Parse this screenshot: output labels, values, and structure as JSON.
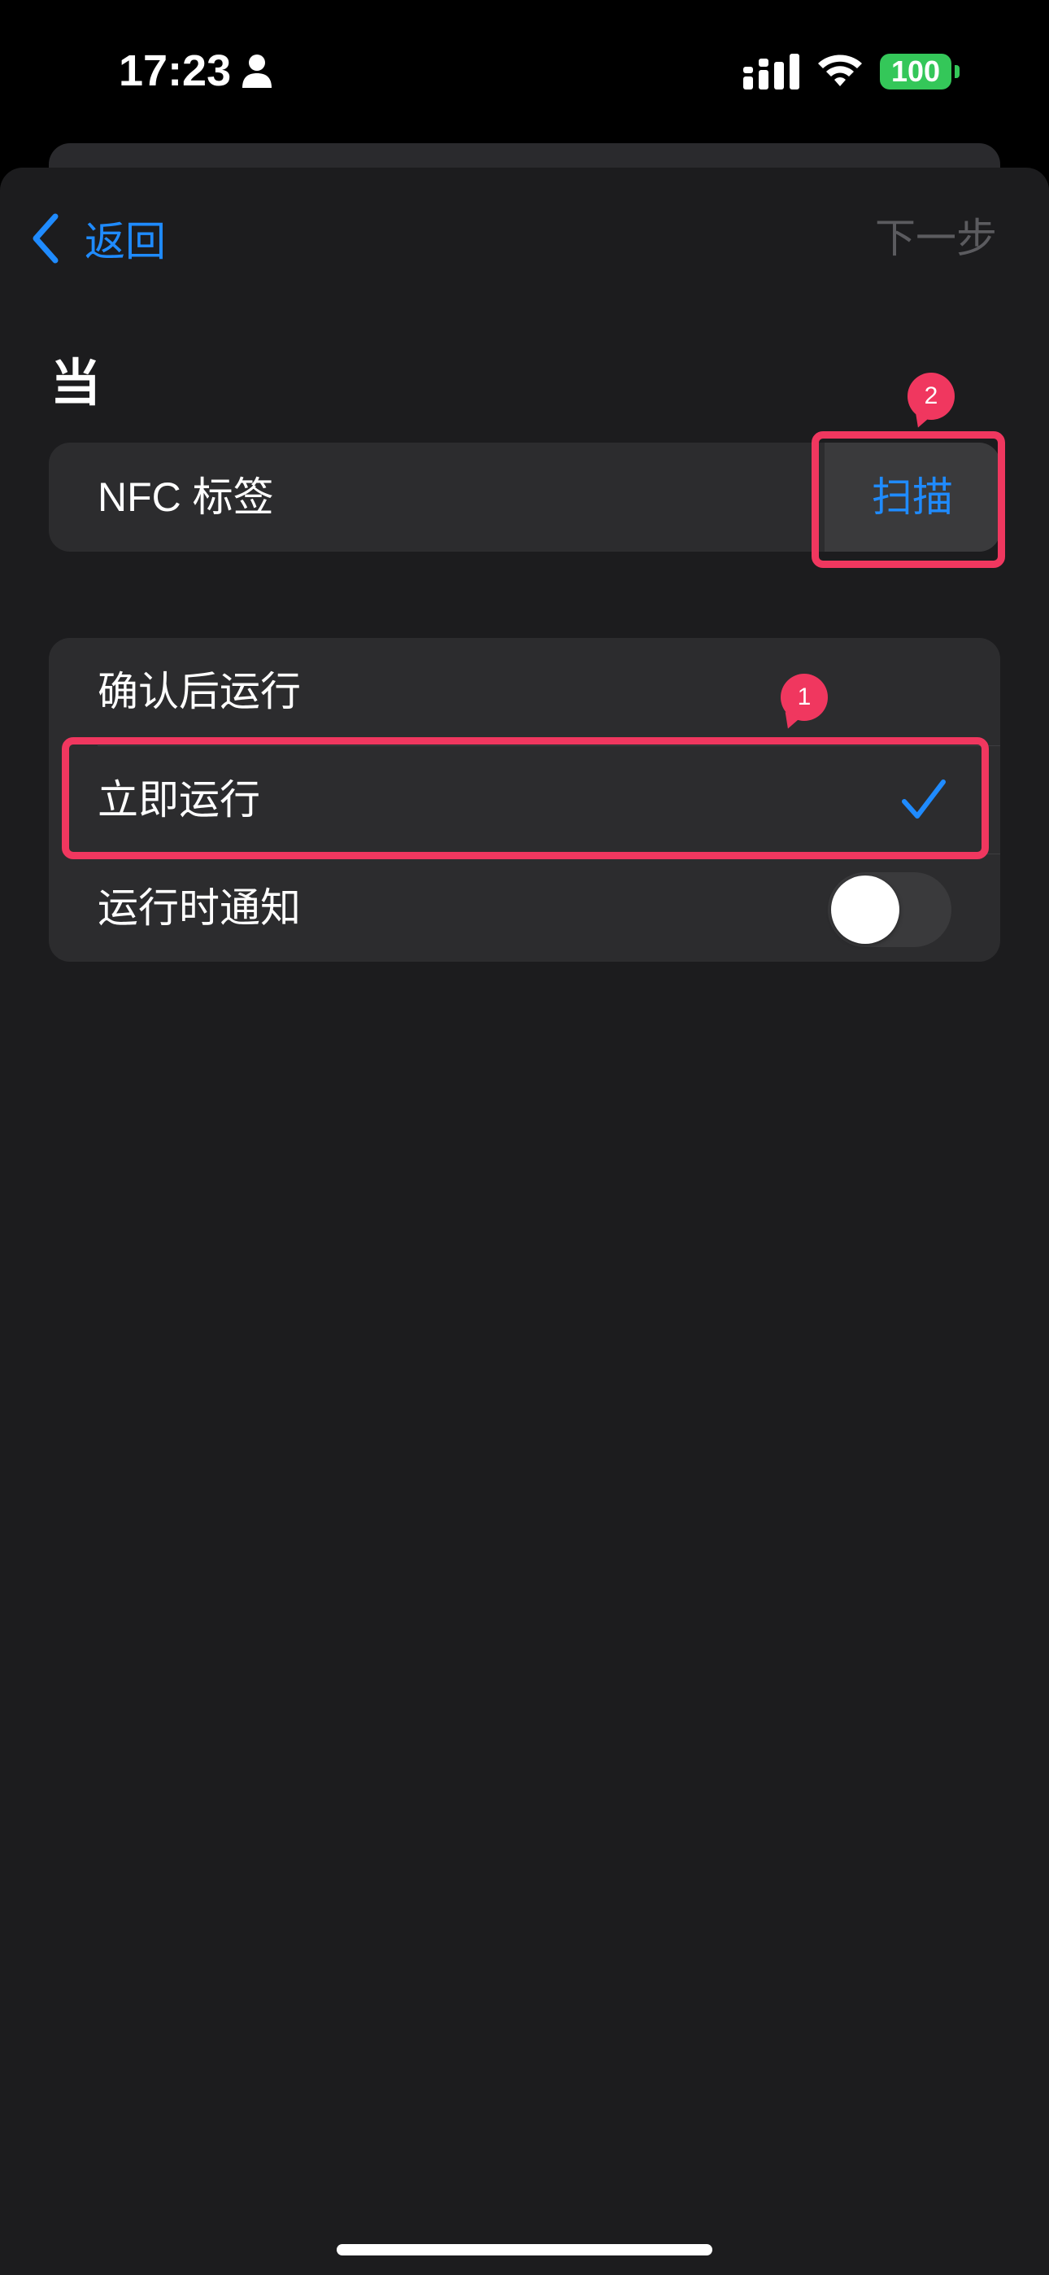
{
  "status_bar": {
    "time": "17:23",
    "battery": "100",
    "icons": [
      "person-icon",
      "cellular-signal-icon",
      "wifi-icon",
      "battery-icon"
    ]
  },
  "nav": {
    "back_label": "返回",
    "next_label": "下一步"
  },
  "section": {
    "title": "当"
  },
  "trigger": {
    "label": "NFC 标签",
    "scan_label": "扫描"
  },
  "options": {
    "ask_before_running": "确认后运行",
    "run_immediately": "立即运行",
    "notify_when_run": "运行时通知",
    "selected": "立即运行",
    "notify_enabled": false
  },
  "annotations": {
    "badge_1": "1",
    "badge_2": "2"
  },
  "colors": {
    "accent": "#1f8bff",
    "annotation": "#f0375f",
    "battery": "#34c759",
    "background": "#1c1c1e",
    "cell": "#2c2c2e"
  }
}
